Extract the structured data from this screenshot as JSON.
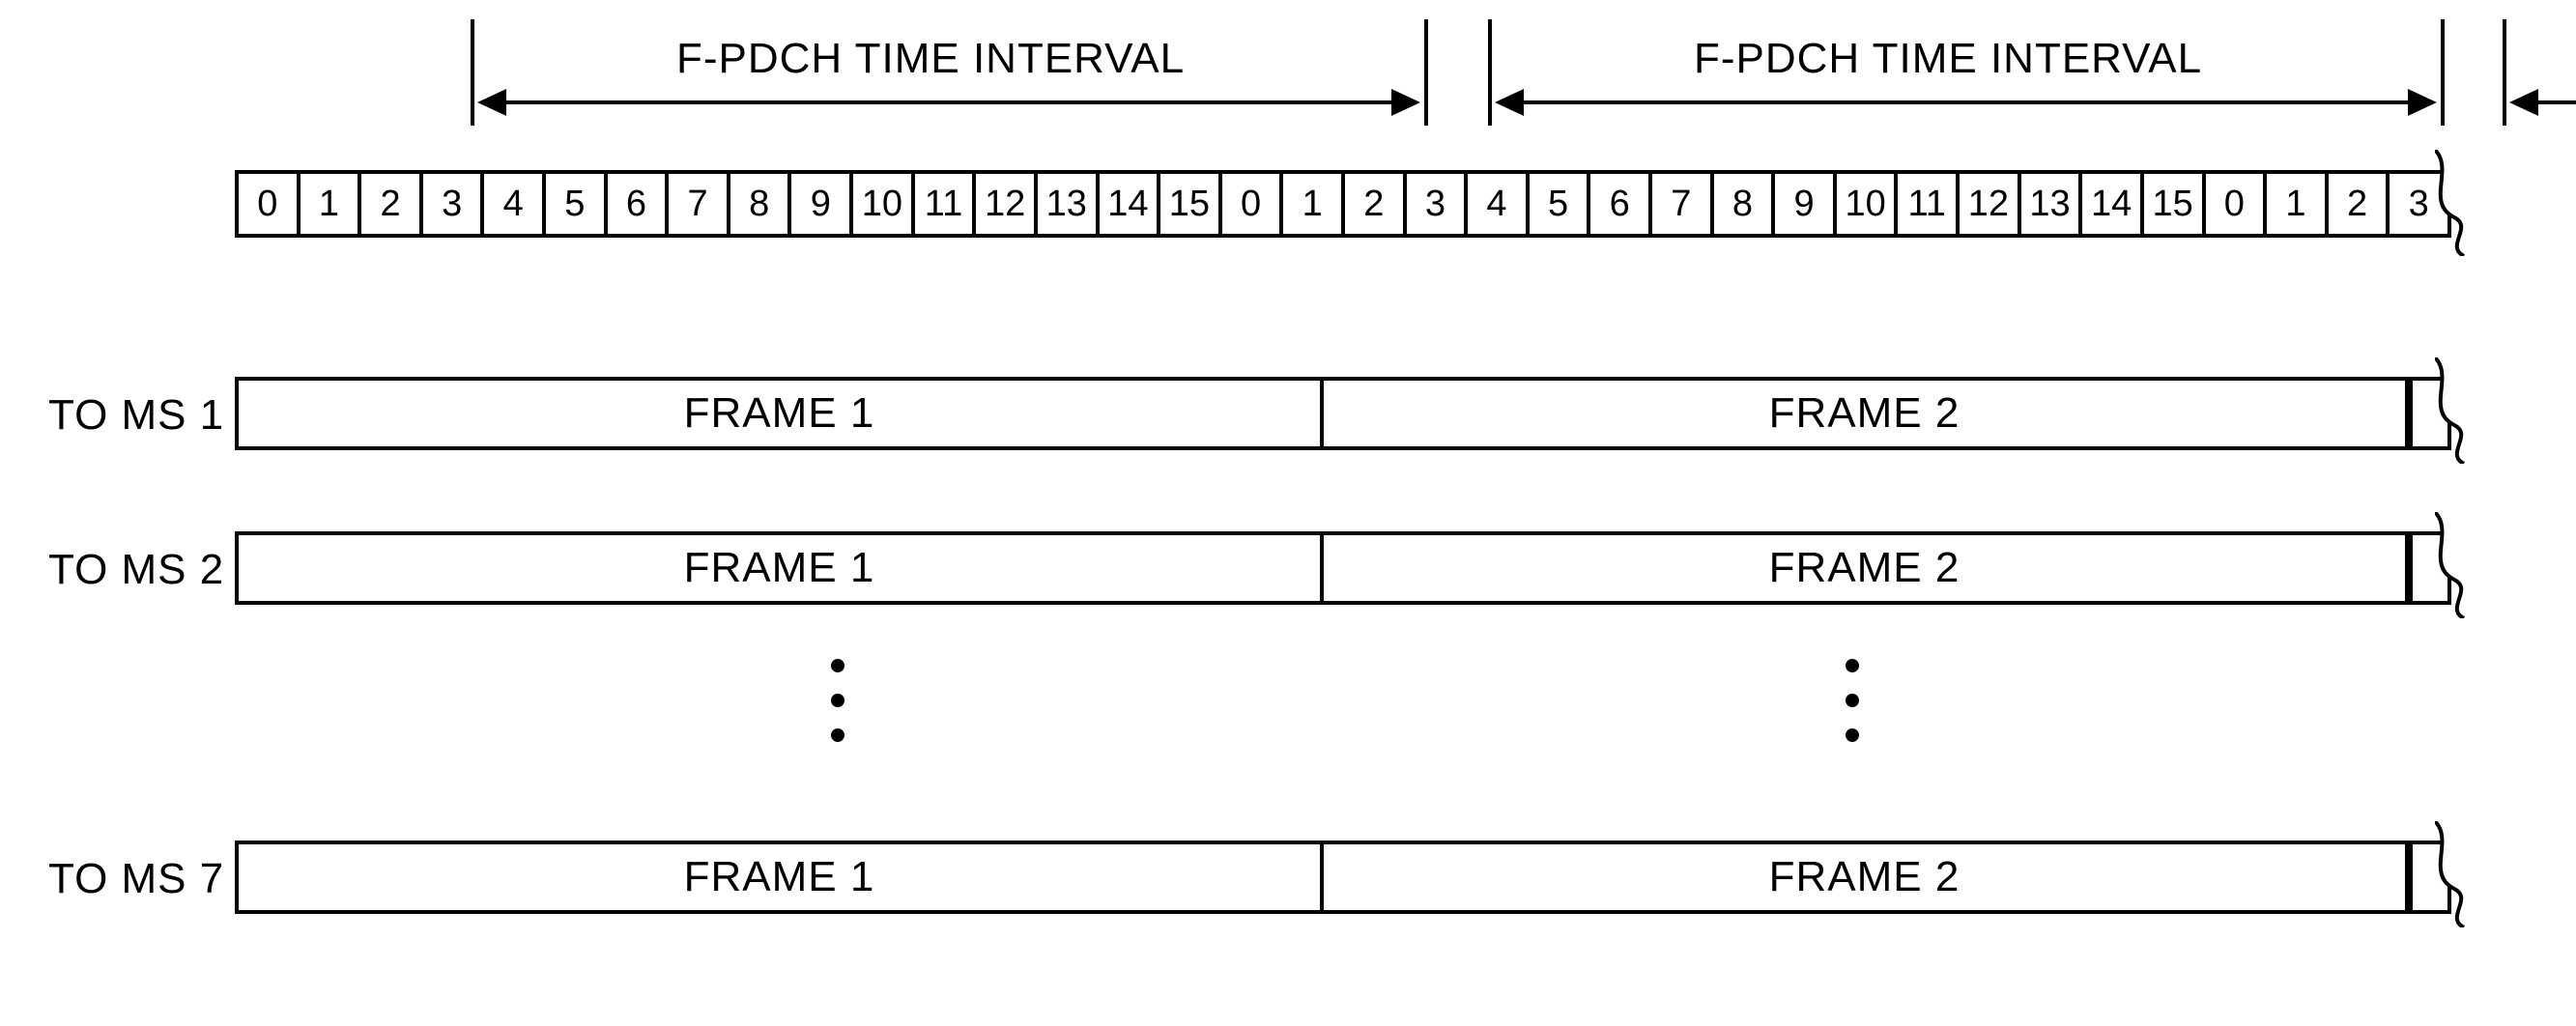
{
  "intervals": {
    "label1": "F-PDCH TIME INTERVAL",
    "label2": "F-PDCH TIME INTERVAL"
  },
  "slots": [
    "0",
    "1",
    "2",
    "3",
    "4",
    "5",
    "6",
    "7",
    "8",
    "9",
    "10",
    "11",
    "12",
    "13",
    "14",
    "15",
    "0",
    "1",
    "2",
    "3",
    "4",
    "5",
    "6",
    "7",
    "8",
    "9",
    "10",
    "11",
    "12",
    "13",
    "14",
    "15",
    "0",
    "1",
    "2",
    "3"
  ],
  "rows": [
    {
      "label": "TO MS 1",
      "frames": [
        "FRAME 1",
        "FRAME 2"
      ]
    },
    {
      "label": "TO MS 2",
      "frames": [
        "FRAME 1",
        "FRAME 2"
      ]
    },
    {
      "label": "TO MS 7",
      "frames": [
        "FRAME 1",
        "FRAME 2"
      ]
    }
  ]
}
